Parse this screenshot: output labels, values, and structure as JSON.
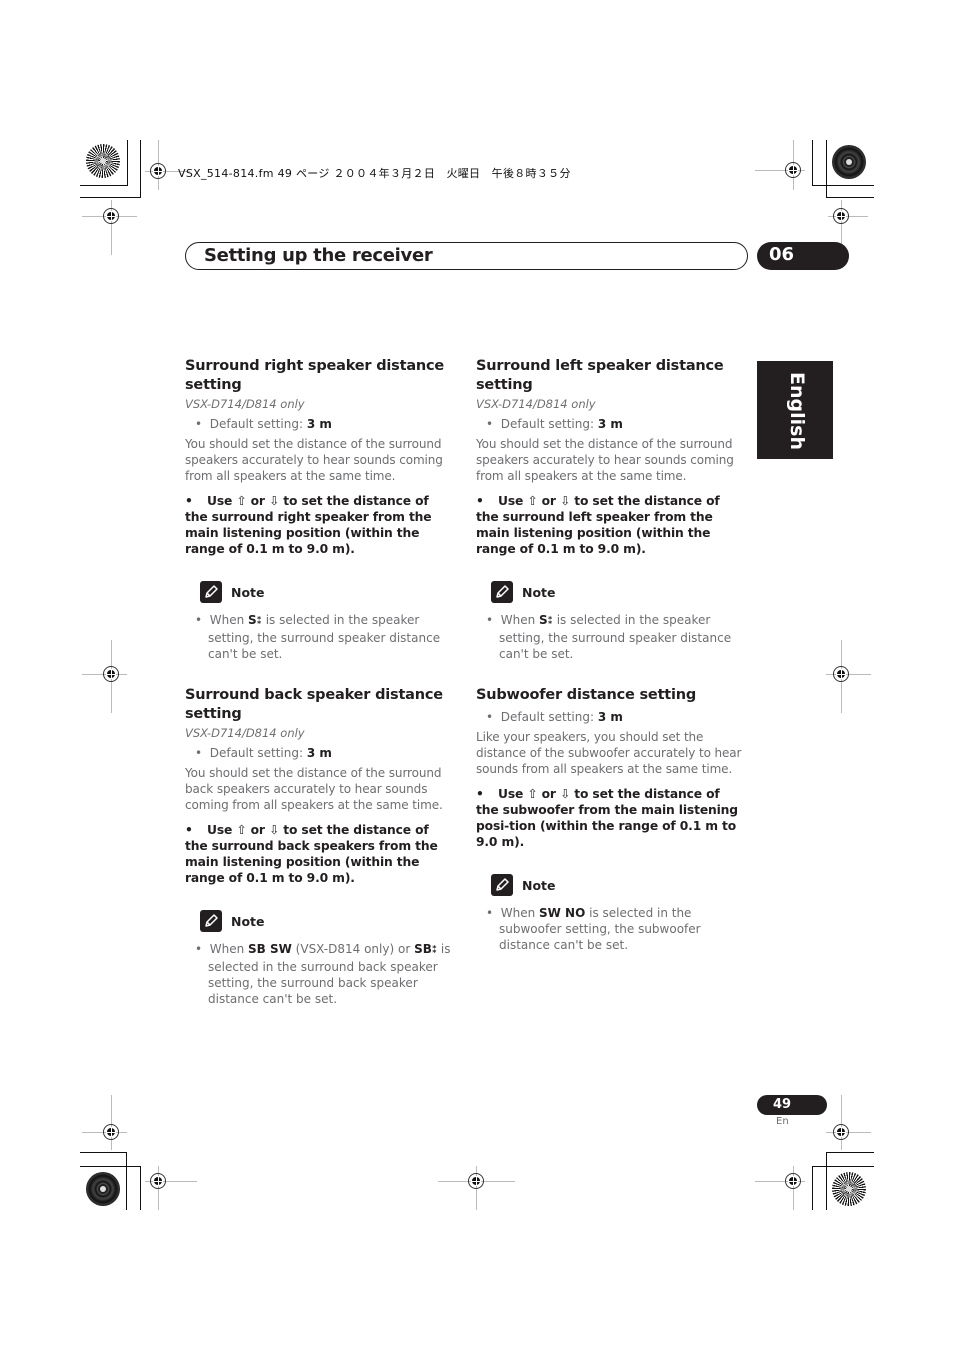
{
  "file_header": "VSX_514-814.fm  49 ページ  ２００４年３月２日　火曜日　午後８時３５分",
  "header": {
    "section_title": "Setting up the receiver",
    "chapter_number": "06"
  },
  "language_tab": "English",
  "icons": {
    "up_arrow": "⇧",
    "down_arrow": "⇩",
    "speaker_symbol": "⁑",
    "note_icon": "pencil-icon"
  },
  "sections": {
    "surround_right": {
      "title": "Surround right speaker distance setting",
      "model": "VSX-D714/D814 only",
      "default_label": "Default setting: ",
      "default_value": "3 m",
      "body": "You should set the distance of the surround speakers accurately to hear sounds coming from all speakers at the same time.",
      "instr_pre": "Use ",
      "instr_or": " or ",
      "instr_post": " to set the distance of the surround right speaker from the main listening position (within the range of 0.1 m to 9.0 m).",
      "note_label": "Note",
      "note_pre": "When ",
      "note_bold": "S",
      "note_post": " is selected in the speaker setting, the surround speaker distance can't be set."
    },
    "surround_left": {
      "title": "Surround left speaker distance setting",
      "model": "VSX-D714/D814 only",
      "default_label": "Default setting: ",
      "default_value": "3 m",
      "body": "You should set the distance of the surround speakers accurately to hear sounds coming from all speakers at the same time.",
      "instr_pre": "Use ",
      "instr_or": " or ",
      "instr_post": " to set the distance of the surround left speaker from the main listening position (within the range of 0.1 m to 9.0 m).",
      "note_label": "Note",
      "note_pre": "When ",
      "note_bold": "S",
      "note_post": " is selected in the speaker setting, the surround speaker distance can't be set."
    },
    "surround_back": {
      "title": "Surround back speaker distance setting",
      "model": "VSX-D714/D814 only",
      "default_label": "Default setting: ",
      "default_value": "3 m",
      "body": "You should set the distance of the surround back speakers accurately to hear sounds coming from all speakers at the same time.",
      "instr_pre": "Use ",
      "instr_or": " or ",
      "instr_post": " to set the distance of the surround back speakers from the main listening position (within the range of 0.1 m to 9.0 m).",
      "note_label": "Note",
      "note_pre": "When ",
      "note_bold1": "SB SW",
      "note_mid": " (VSX-D814 only) or ",
      "note_bold2": "SB",
      "note_post": " is selected in the surround back speaker setting, the surround back speaker distance can't be set."
    },
    "subwoofer": {
      "title": "Subwoofer distance setting",
      "default_label": "Default setting: ",
      "default_value": "3 m",
      "body": "Like your speakers, you should set the distance of the subwoofer accurately to hear sounds from all speakers at the same time.",
      "instr_pre": "Use ",
      "instr_or": " or ",
      "instr_post": " to set the distance of the subwoofer from the main listening posi-tion (within the range of 0.1 m to 9.0 m).",
      "note_label": "Note",
      "note_pre": "When ",
      "note_bold": "SW NO",
      "note_post": " is selected in the subwoofer setting, the subwoofer distance can't be set."
    }
  },
  "footer": {
    "page_number": "49",
    "page_lang": "En"
  }
}
